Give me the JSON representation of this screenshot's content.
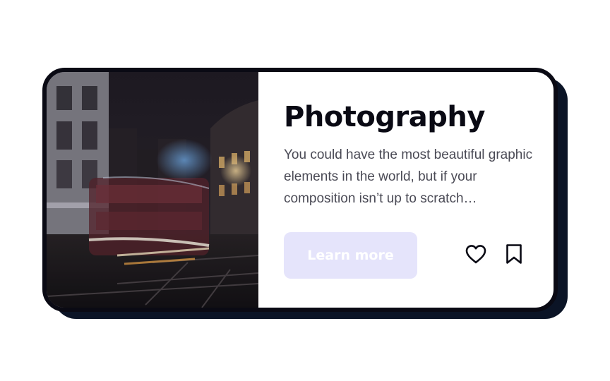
{
  "card": {
    "image_alt": "Night street with a blurred red double-decker bus",
    "title": "Photography",
    "description": "You could have the most beautiful graphic elements in the world, but if your composition isn’t up to scratch…",
    "cta_label": "Learn more",
    "icons": {
      "favorite": "heart-icon",
      "save": "bookmark-icon"
    }
  },
  "colors": {
    "card_border": "#0a0a14",
    "card_shadow": "#0b1426",
    "title": "#0a0a14",
    "text": "#4a4a55",
    "button_bg": "#e5e4fb",
    "button_text": "#ffffff"
  }
}
